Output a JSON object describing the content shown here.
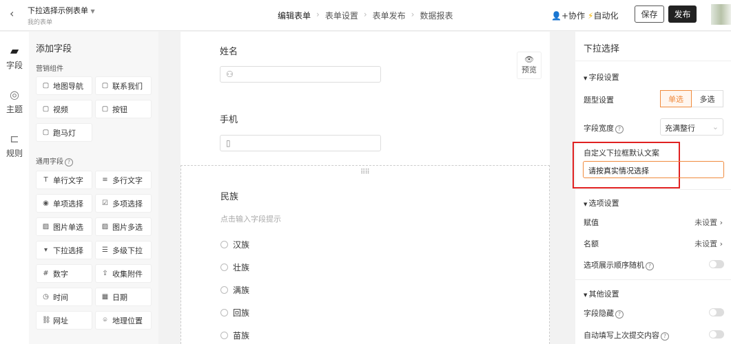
{
  "header": {
    "title": "下拉选择示例表单",
    "subtitle": "我的表单",
    "steps": [
      "编辑表单",
      "表单设置",
      "表单发布",
      "数据报表"
    ],
    "collab": "协作",
    "automation": "自动化",
    "save": "保存",
    "publish": "发布"
  },
  "rail": [
    {
      "label": "字段",
      "icon": "document-edit-icon"
    },
    {
      "label": "主题",
      "icon": "palette-icon"
    },
    {
      "label": "规则",
      "icon": "flow-icon"
    }
  ],
  "fields": {
    "title": "添加字段",
    "marketing_title": "营销组件",
    "marketing": [
      {
        "label": "地图导航",
        "icon": "map"
      },
      {
        "label": "联系我们",
        "icon": "phone"
      },
      {
        "label": "视频",
        "icon": "video"
      },
      {
        "label": "按钮",
        "icon": "button"
      },
      {
        "label": "跑马灯",
        "icon": "marquee"
      }
    ],
    "common_title": "通用字段",
    "common": [
      {
        "label": "单行文字",
        "icon": "T"
      },
      {
        "label": "多行文字",
        "icon": "≡"
      },
      {
        "label": "单项选择",
        "icon": "◉"
      },
      {
        "label": "多项选择",
        "icon": "☑"
      },
      {
        "label": "图片单选",
        "icon": "▨"
      },
      {
        "label": "图片多选",
        "icon": "▨"
      },
      {
        "label": "下拉选择",
        "icon": "▾"
      },
      {
        "label": "多级下拉",
        "icon": "☰"
      },
      {
        "label": "数字",
        "icon": "#"
      },
      {
        "label": "收集附件",
        "icon": "⇪"
      },
      {
        "label": "时间",
        "icon": "◷"
      },
      {
        "label": "日期",
        "icon": "▦"
      },
      {
        "label": "网址",
        "icon": "⛓"
      },
      {
        "label": "地理位置",
        "icon": "⌾"
      }
    ]
  },
  "form": {
    "name_label": "姓名",
    "phone_label": "手机",
    "ethnic_label": "民族",
    "ethnic_hint": "点击输入字段提示",
    "options": [
      "汉族",
      "壮族",
      "满族",
      "回族",
      "苗族"
    ],
    "preview": "预览"
  },
  "right": {
    "title": "下拉选择",
    "field_settings": "字段设置",
    "type_label": "题型设置",
    "type_options": [
      "单选",
      "多选"
    ],
    "width_label": "字段宽度",
    "width_value": "充满整行",
    "custom_label": "自定义下拉框默认文案",
    "custom_value": "请按真实情况选择",
    "option_settings": "选项设置",
    "assign_label": "赋值",
    "assign_value": "未设置",
    "quota_label": "名额",
    "quota_value": "未设置",
    "random_label": "选项展示顺序随机",
    "other_settings": "其他设置",
    "hide_label": "字段隐藏",
    "autofill_label": "自动填写上次提交内容"
  },
  "colors": {
    "accent": "#f08a3c",
    "highlight": "#e02020"
  }
}
